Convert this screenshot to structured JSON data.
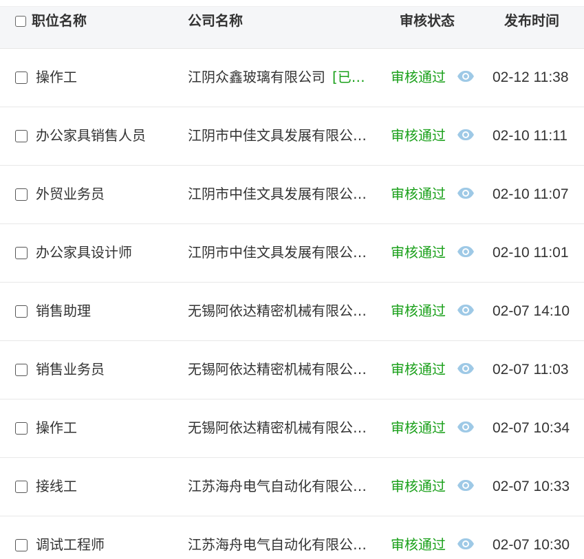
{
  "header": {
    "col_title": "职位名称",
    "col_company": "公司名称",
    "col_status": "审核状态",
    "col_time": "发布时间"
  },
  "colors": {
    "status_green": "#1aa01a",
    "eye_icon": "#9ec9e6",
    "header_bg": "#f5f6f8"
  },
  "rows": [
    {
      "title": "操作工",
      "company": "江阴众鑫玻璃有限公司",
      "company_tag": "[已…",
      "status": "审核通过",
      "time": "02-12 11:38"
    },
    {
      "title": "办公家具销售人员",
      "company": "江阴市中佳文具发展有限公…",
      "company_tag": "",
      "status": "审核通过",
      "time": "02-10 11:11"
    },
    {
      "title": "外贸业务员",
      "company": "江阴市中佳文具发展有限公…",
      "company_tag": "",
      "status": "审核通过",
      "time": "02-10 11:07"
    },
    {
      "title": "办公家具设计师",
      "company": "江阴市中佳文具发展有限公…",
      "company_tag": "",
      "status": "审核通过",
      "time": "02-10 11:01"
    },
    {
      "title": "销售助理",
      "company": "无锡阿依达精密机械有限公…",
      "company_tag": "",
      "status": "审核通过",
      "time": "02-07 14:10"
    },
    {
      "title": "销售业务员",
      "company": "无锡阿依达精密机械有限公…",
      "company_tag": "",
      "status": "审核通过",
      "time": "02-07 11:03"
    },
    {
      "title": "操作工",
      "company": "无锡阿依达精密机械有限公…",
      "company_tag": "",
      "status": "审核通过",
      "time": "02-07 10:34"
    },
    {
      "title": "接线工",
      "company": "江苏海舟电气自动化有限公…",
      "company_tag": "",
      "status": "审核通过",
      "time": "02-07 10:33"
    },
    {
      "title": "调试工程师",
      "company": "江苏海舟电气自动化有限公…",
      "company_tag": "",
      "status": "审核通过",
      "time": "02-07 10:30"
    }
  ]
}
